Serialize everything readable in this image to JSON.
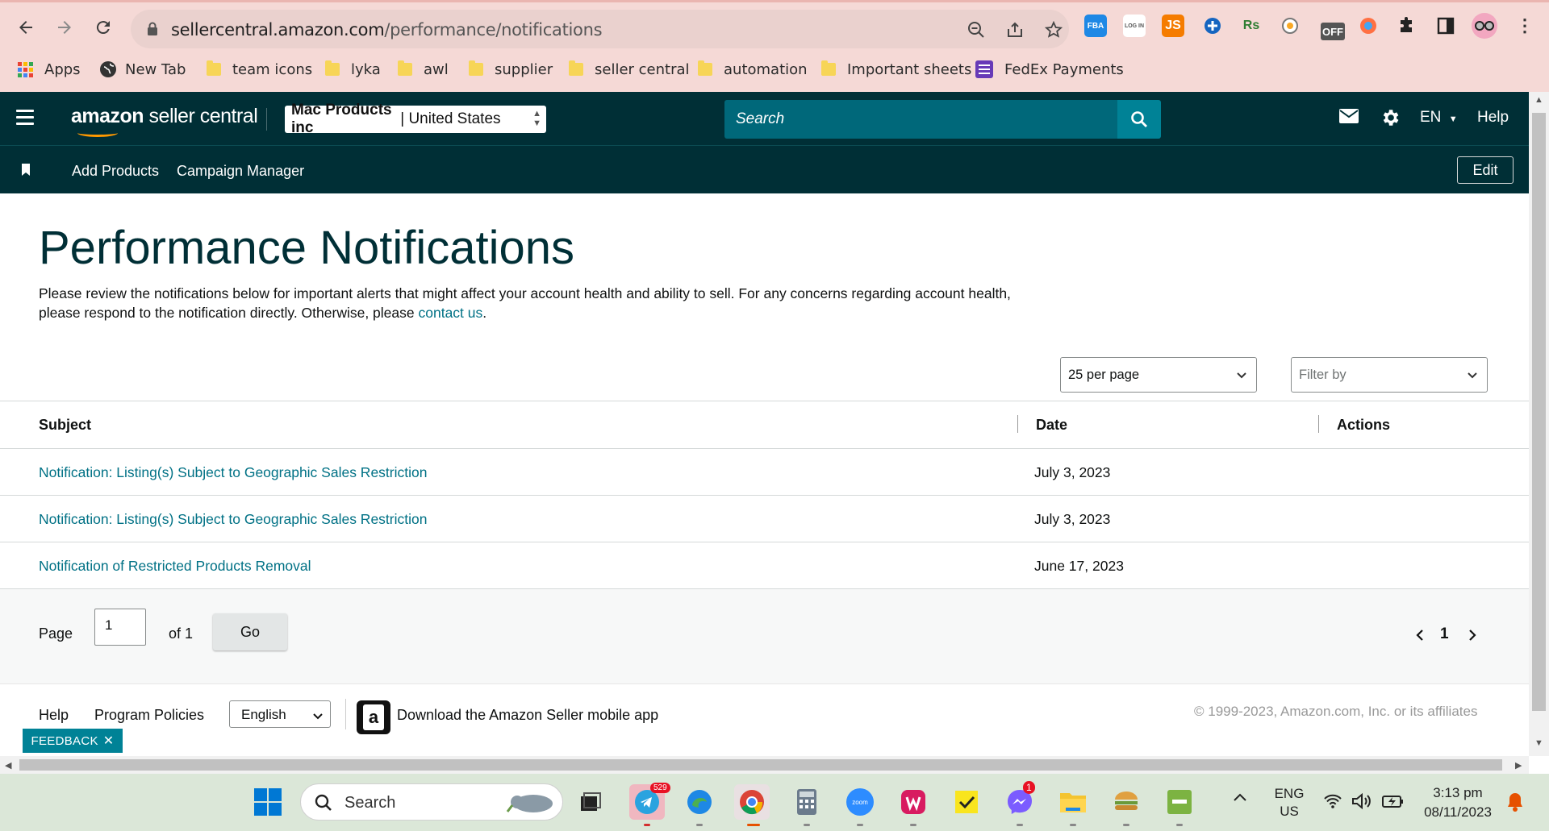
{
  "browser": {
    "url_host": "sellercentral.amazon.com",
    "url_path": "/performance/notifications",
    "bookmarks": [
      {
        "label": "Apps",
        "type": "apps"
      },
      {
        "label": "New Tab",
        "type": "globe"
      },
      {
        "label": "team icons",
        "type": "folder"
      },
      {
        "label": "lyka",
        "type": "folder"
      },
      {
        "label": "awl",
        "type": "folder"
      },
      {
        "label": "supplier",
        "type": "folder"
      },
      {
        "label": "seller central",
        "type": "folder"
      },
      {
        "label": "automation",
        "type": "folder"
      },
      {
        "label": "Important sheets",
        "type": "folder"
      },
      {
        "label": "FedEx Payments",
        "type": "forms"
      }
    ],
    "extensions": [
      "FBA",
      "LOG IN",
      "JS",
      "OFF"
    ]
  },
  "header": {
    "logo_bold": "amazon",
    "logo_rest": " seller central",
    "account_bold": "Mac Products inc",
    "account_rest": "| United States",
    "search_placeholder": "Search",
    "language": "EN",
    "help": "Help"
  },
  "subnav": {
    "links": [
      "Add Products",
      "Campaign Manager"
    ],
    "edit": "Edit"
  },
  "page": {
    "title": "Performance Notifications",
    "description": "Please review the notifications below for important alerts that might affect your account health and ability to sell. For any concerns regarding account health, please respond to the notification directly. Otherwise, please ",
    "contact_link": "contact us",
    "description_end": ".",
    "per_page": "25 per page",
    "filter_placeholder": "Filter by"
  },
  "table": {
    "columns": [
      "Subject",
      "Date",
      "Actions"
    ],
    "rows": [
      {
        "subject": "Notification: Listing(s) Subject to Geographic Sales Restriction",
        "date": "July 3, 2023"
      },
      {
        "subject": "Notification: Listing(s) Subject to Geographic Sales Restriction",
        "date": "July 3, 2023"
      },
      {
        "subject": "Notification of Restricted Products Removal",
        "date": "June 17, 2023"
      }
    ]
  },
  "pagination": {
    "page_label": "Page",
    "page_value": "1",
    "of_label": "of 1",
    "go": "Go",
    "current": "1"
  },
  "footer": {
    "help": "Help",
    "policies": "Program Policies",
    "language": "English",
    "app_text": "Download the Amazon Seller mobile app",
    "copyright": "© 1999-2023, Amazon.com, Inc. or its affiliates",
    "feedback": "FEEDBACK"
  },
  "taskbar": {
    "search": "Search",
    "telegram_badge": "529",
    "messenger_badge": "1",
    "lang_line1": "ENG",
    "lang_line2": "US",
    "time": "3:13 pm",
    "date": "08/11/2023"
  },
  "colors": {
    "amazon_header": "#002f36",
    "link": "#007185",
    "search": "#00687a",
    "feedback": "#008296"
  }
}
